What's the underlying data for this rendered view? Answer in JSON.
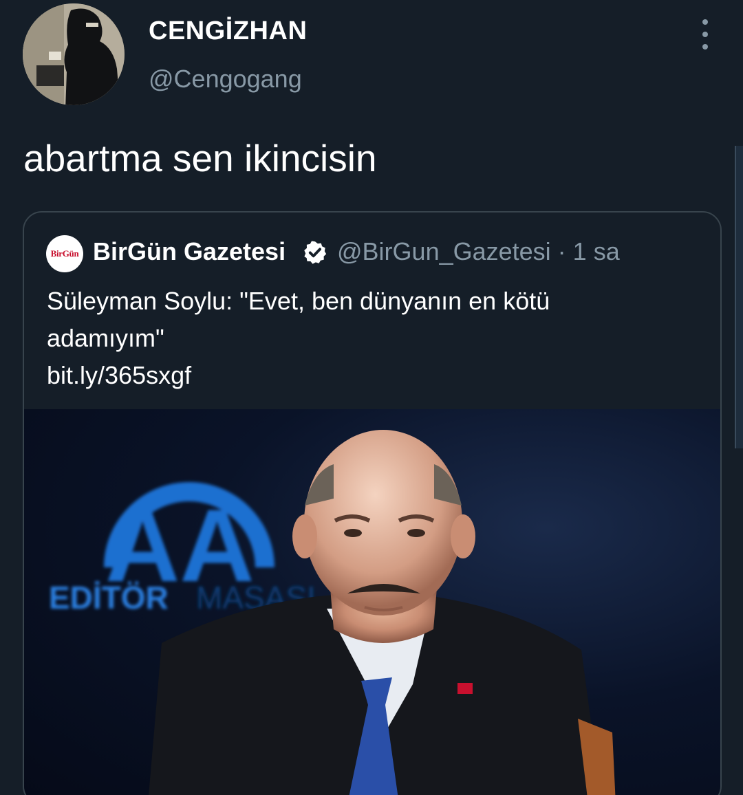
{
  "author": {
    "display_name": "CENGİZHAN",
    "handle": "@Cengogang"
  },
  "tweet": {
    "text": "abartma sen ikincisin"
  },
  "quoted": {
    "logo_text": "BirGün",
    "display_name": "BirGün Gazetesi",
    "handle_time": "@BirGun_Gazetesi · 1 sa",
    "text_line1": "Süleyman Soylu: \"Evet, ben dünyanın en kötü",
    "text_line2": "adamıyım\"",
    "link": "bit.ly/365sxgf",
    "image_backdrop_text_1": "AA",
    "image_backdrop_text_2": "EDİTÖR",
    "image_backdrop_text_3": "MASASI"
  },
  "icons": {
    "more": "more-vertical-icon",
    "verified": "verified-badge-icon"
  },
  "colors": {
    "background": "#151e28",
    "secondary_text": "#8899a6",
    "border": "#38444d",
    "aa_blue": "#1d6fd0"
  }
}
